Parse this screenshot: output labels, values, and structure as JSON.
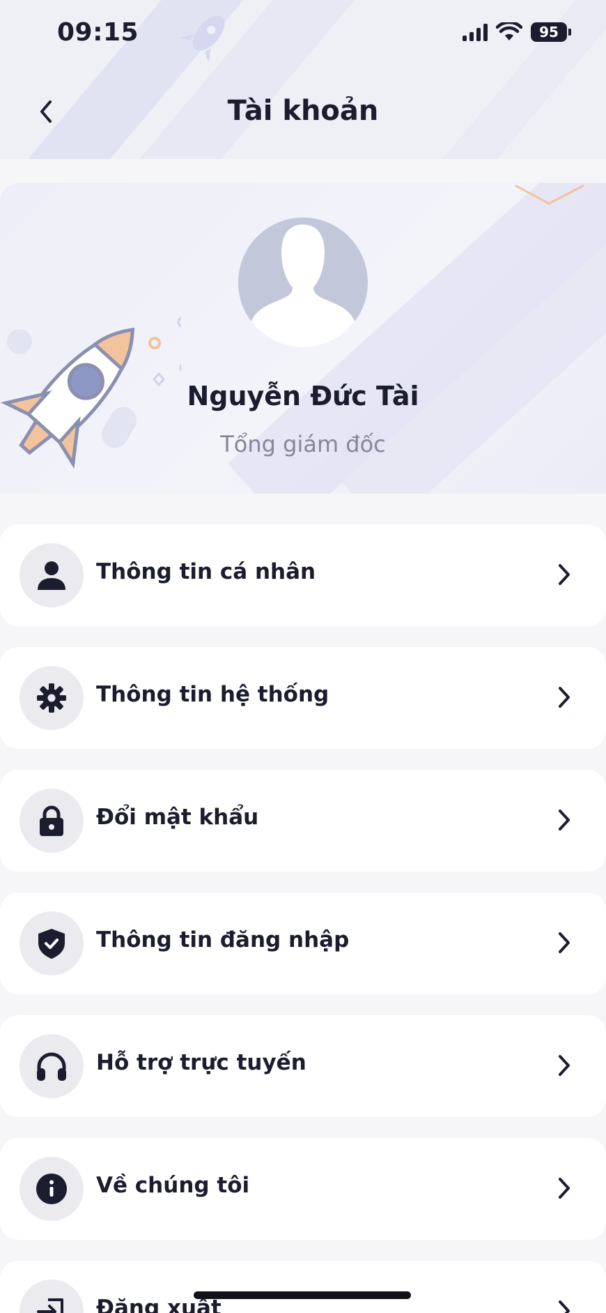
{
  "status_bar": {
    "time": "09:15",
    "battery": "95"
  },
  "header": {
    "title": "Tài khoản",
    "back_icon": "chevron-left-icon"
  },
  "profile": {
    "name": "Nguyễn Đức Tài",
    "role": "Tổng giám đốc"
  },
  "menu": {
    "items": [
      {
        "label": "Thông tin cá nhân",
        "icon": "person-icon"
      },
      {
        "label": "Thông tin hệ thống",
        "icon": "gear-icon"
      },
      {
        "label": "Đổi mật khẩu",
        "icon": "lock-icon"
      },
      {
        "label": "Thông tin đăng nhập",
        "icon": "shield-check-icon"
      },
      {
        "label": "Hỗ trợ trực tuyến",
        "icon": "headphones-icon"
      },
      {
        "label": "Về chúng tôi",
        "icon": "info-icon"
      },
      {
        "label": "Đăng xuất",
        "icon": "logout-icon"
      }
    ]
  },
  "colors": {
    "text": "#1b1d2e",
    "muted": "#858696",
    "icon_bg": "#ebebef",
    "rocket_accent": "#f2c39c",
    "rocket_outline": "#8b8fb0"
  }
}
